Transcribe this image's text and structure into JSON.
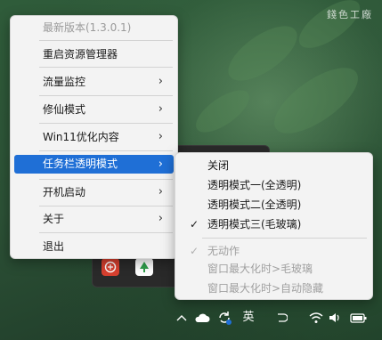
{
  "brand_text": "錢色工廠",
  "menu": {
    "items": [
      {
        "label": "最新版本(1.3.0.1)",
        "disabled": true,
        "arrow": false
      },
      {
        "label": "重启资源管理器",
        "arrow": false
      },
      {
        "label": "流量监控",
        "arrow": true
      },
      {
        "label": "修仙模式",
        "arrow": true
      },
      {
        "label": "Win11优化内容",
        "arrow": true
      },
      {
        "label": "任务栏透明模式",
        "arrow": true,
        "highlighted": true
      },
      {
        "label": "开机启动",
        "arrow": true
      },
      {
        "label": "关于",
        "arrow": true
      },
      {
        "label": "退出",
        "arrow": false
      }
    ],
    "arrow_glyph": "›"
  },
  "submenu": {
    "items": [
      {
        "label": "关闭",
        "checked": false
      },
      {
        "label": "透明模式一(全透明)",
        "checked": false
      },
      {
        "label": "透明模式二(全透明)",
        "checked": false
      },
      {
        "label": "透明模式三(毛玻璃)",
        "checked": true
      }
    ],
    "secondary": [
      {
        "label": "无动作",
        "checked": true,
        "disabled": true
      },
      {
        "label": "窗口最大化时>毛玻璃",
        "disabled": true
      },
      {
        "label": "窗口最大化时>自动隐藏",
        "disabled": true
      }
    ],
    "check_glyph": "✓"
  },
  "taskbar": {
    "chevron": "^",
    "ime": "英",
    "accent": "#1f6fd6"
  }
}
